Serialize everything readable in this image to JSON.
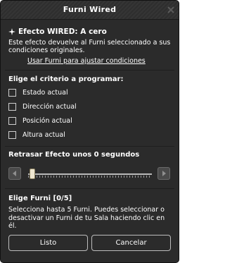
{
  "window": {
    "title": "Furni Wired"
  },
  "effect": {
    "title": "Efecto WIRED: A cero",
    "description": "Este efecto devuelve al Furni seleccionado a sus condiciones originales.",
    "link": "Usar Furni para ajustar condiciones"
  },
  "criteria": {
    "heading": "Elige el criterio a programar:",
    "options": [
      {
        "label": "Estado actual",
        "checked": false
      },
      {
        "label": "Dirección actual",
        "checked": false
      },
      {
        "label": "Posición actual",
        "checked": false
      },
      {
        "label": "Altura actual",
        "checked": false
      }
    ]
  },
  "delay": {
    "heading": "Retrasar Efecto unos 0 segundos",
    "value": 0
  },
  "furni": {
    "heading": "Elige Furni [0/5]",
    "description": "Selecciona hasta 5 Furni. Puedes seleccionar o desactivar un Furni de tu Sala haciendo clic en él."
  },
  "buttons": {
    "ok": "Listo",
    "cancel": "Cancelar"
  },
  "colors": {
    "background": "#2b2b2b",
    "text": "#ffffff",
    "border": "#bdbdbd"
  }
}
